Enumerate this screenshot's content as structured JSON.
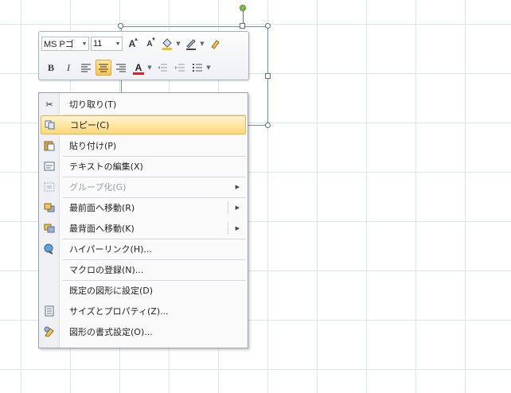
{
  "mini_toolbar": {
    "font_name": "MS Pゴ",
    "font_size": "11",
    "grow_font": "A",
    "shrink_font": "A",
    "bold": "B",
    "italic": "I",
    "font_color": "A"
  },
  "context_menu": {
    "items": [
      {
        "label": "切り取り(T)",
        "icon": "scissors-icon"
      },
      {
        "label": "コピー(C)",
        "icon": "copy-icon",
        "highlighted": true
      },
      {
        "label": "貼り付け(P)",
        "icon": "paste-icon"
      },
      {
        "label": "テキストの編集(X)",
        "icon": "edit-text-icon"
      },
      {
        "label": "グループ化(G)",
        "icon": "group-icon",
        "disabled": true,
        "submenu": true
      },
      {
        "label": "最前面へ移動(R)",
        "icon": "bring-to-front-icon",
        "submenu": true
      },
      {
        "label": "最背面へ移動(K)",
        "icon": "send-to-back-icon",
        "submenu": true
      },
      {
        "label": "ハイパーリンク(H)...",
        "icon": "hyperlink-icon"
      },
      {
        "label": "マクロの登録(N)..."
      },
      {
        "label": "既定の図形に設定(D)"
      },
      {
        "label": "サイズとプロパティ(Z)...",
        "icon": "size-properties-icon"
      },
      {
        "label": "図形の書式設定(O)...",
        "icon": "format-shape-icon"
      }
    ]
  },
  "colors": {
    "highlight": "#ffd97a",
    "font_color_bar": "#e02020",
    "rotation_handle": "#7ec04a"
  }
}
